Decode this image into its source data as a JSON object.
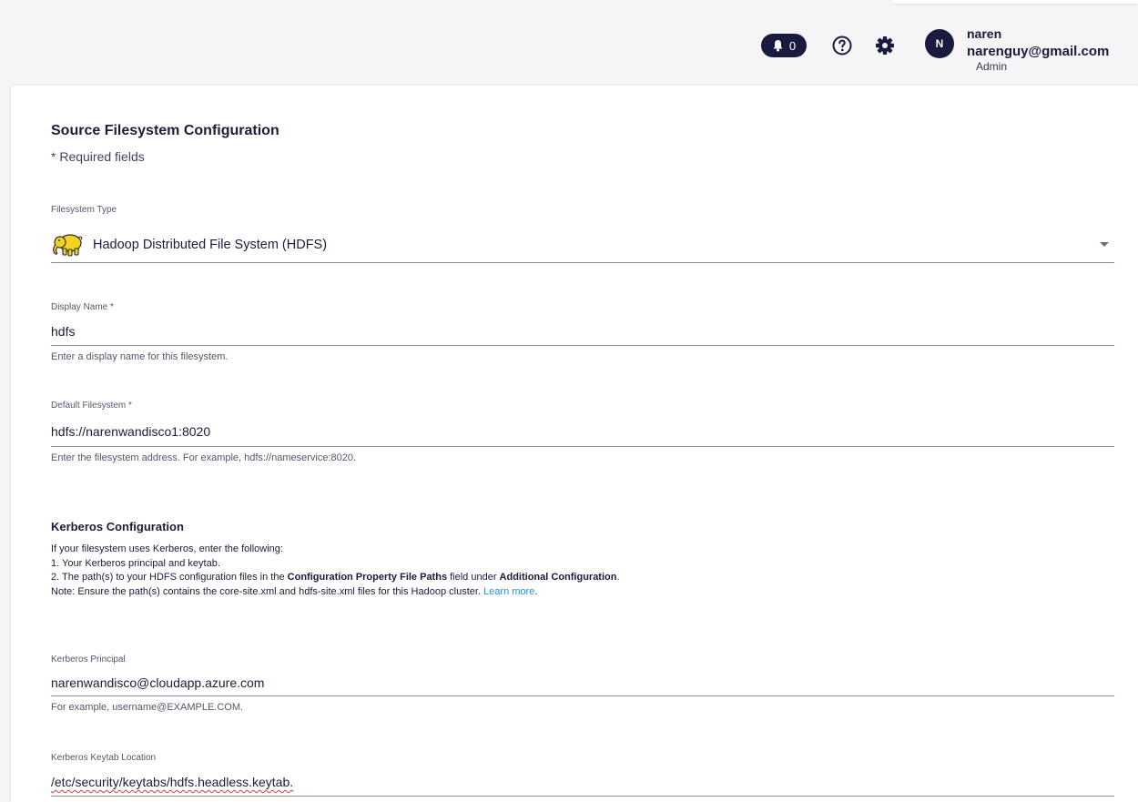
{
  "header": {
    "notifications_count": "0",
    "avatar_initial": "N",
    "user_name": "naren",
    "user_email": "narenguy@gmail.com",
    "user_role": "Admin",
    "icons": [
      "bell-icon",
      "help-icon",
      "gear-icon"
    ]
  },
  "form": {
    "title": "Source Filesystem Configuration",
    "required_note": "* Required fields",
    "filesystem_type": {
      "label": "Filesystem Type",
      "value": "Hadoop Distributed File System (HDFS)"
    },
    "display_name": {
      "label": "Display Name *",
      "value": "hdfs",
      "helper": "Enter a display name for this filesystem."
    },
    "default_filesystem": {
      "label": "Default Filesystem *",
      "value": "hdfs://narenwandisco1:8020",
      "helper": "Enter the filesystem address. For example, hdfs://nameservice:8020."
    },
    "kerberos": {
      "title": "Kerberos Configuration",
      "line1": "If your filesystem uses Kerberos, enter the following:",
      "line2": "1. Your Kerberos principal and keytab.",
      "line3_a": "2. The path(s) to your HDFS configuration files in the ",
      "line3_b": "Configuration Property File Paths",
      "line3_c": " field under ",
      "line3_d": "Additional Configuration",
      "line3_e": ".",
      "line4": "Note: Ensure the path(s) contains the core-site.xml and hdfs-site.xml files for this Hadoop cluster. ",
      "learn_more": "Learn more",
      "line4_end": ".",
      "principal": {
        "label": "Kerberos Principal",
        "value": "narenwandisco@cloudapp.azure.com",
        "helper": "For example, username@EXAMPLE.COM."
      },
      "keytab": {
        "label": "Kerberos Keytab Location",
        "value": "/etc/security/keytabs/hdfs.headless.keytab."
      }
    }
  },
  "colors": {
    "navy": "#191a3d",
    "link": "#2f8fd6",
    "background": "#f5f5f7",
    "hadoop_yellow": "#f2d31f"
  }
}
